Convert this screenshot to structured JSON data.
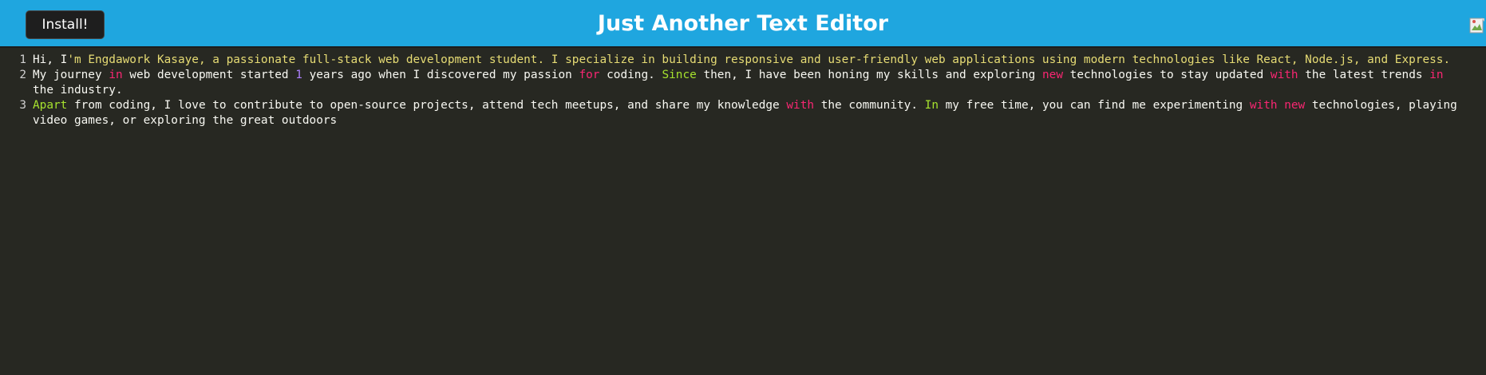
{
  "header": {
    "install_label": "Install!",
    "title": "Just Another Text Editor",
    "logo_icon": "broken-image-icon"
  },
  "editor": {
    "lines": [
      {
        "number": "1",
        "segments": [
          {
            "text": "Hi, I",
            "style": "plain"
          },
          {
            "text": "'m Engdawork Kasaye, a passionate full-stack web development student. I specialize in building responsive and user-friendly web applications using modern technologies like React, Node.js, and Express.",
            "style": "str"
          }
        ]
      },
      {
        "number": "2",
        "segments": [
          {
            "text": "My journey ",
            "style": "plain"
          },
          {
            "text": "in",
            "style": "kw"
          },
          {
            "text": " web development started ",
            "style": "plain"
          },
          {
            "text": "1",
            "style": "num"
          },
          {
            "text": " years ago when I discovered my passion ",
            "style": "plain"
          },
          {
            "text": "for",
            "style": "kw"
          },
          {
            "text": " coding. ",
            "style": "plain"
          },
          {
            "text": "Since",
            "style": "ident"
          },
          {
            "text": " then, I have been honing my skills and exploring ",
            "style": "plain"
          },
          {
            "text": "new",
            "style": "kw"
          },
          {
            "text": " technologies to stay updated ",
            "style": "plain"
          },
          {
            "text": "with",
            "style": "kw"
          },
          {
            "text": " the latest trends ",
            "style": "plain"
          },
          {
            "text": "in",
            "style": "kw"
          },
          {
            "text": " the industry.",
            "style": "plain"
          }
        ]
      },
      {
        "number": "3",
        "segments": [
          {
            "text": "Apart",
            "style": "ident"
          },
          {
            "text": " from coding, I love to contribute to open-source projects, attend tech meetups, and share my knowledge ",
            "style": "plain"
          },
          {
            "text": "with",
            "style": "kw"
          },
          {
            "text": " the community. ",
            "style": "plain"
          },
          {
            "text": "In",
            "style": "ident"
          },
          {
            "text": " my free time, you can find me experimenting ",
            "style": "plain"
          },
          {
            "text": "with",
            "style": "kw"
          },
          {
            "text": " ",
            "style": "plain"
          },
          {
            "text": "new",
            "style": "kw"
          },
          {
            "text": " technologies, playing video games, or exploring the great outdoors",
            "style": "plain"
          }
        ]
      }
    ]
  },
  "colors": {
    "header_bg": "#1fa6df",
    "editor_bg": "#272822",
    "string": "#e6db74",
    "keyword": "#f92672",
    "number": "#ae81ff",
    "identifier": "#a6e22e"
  }
}
